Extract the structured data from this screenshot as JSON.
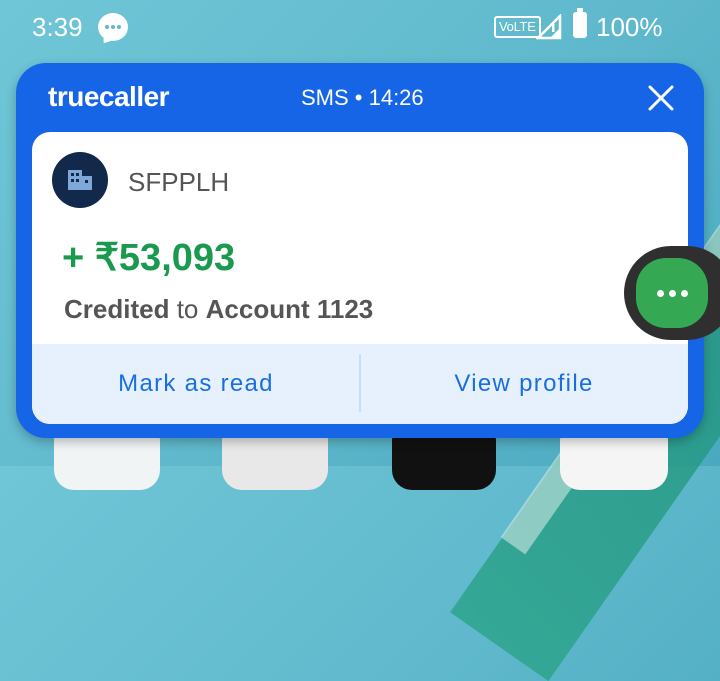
{
  "status_bar": {
    "time": "3:39",
    "volte": "VoLTE",
    "battery_pct": "100%"
  },
  "notification": {
    "app_name": "truecaller",
    "meta": "SMS • 14:26",
    "sender": "SFPPLH",
    "amount": "+ ₹53,093",
    "credited": "Credited",
    "to": "to",
    "account": "Account 1123",
    "actions": {
      "mark_read": "Mark as read",
      "view_profile": "View profile"
    }
  },
  "colors": {
    "card": "#1565e6",
    "amount": "#1a9a4e",
    "action_text": "#1a6fe0",
    "bubble": "#35a853"
  }
}
